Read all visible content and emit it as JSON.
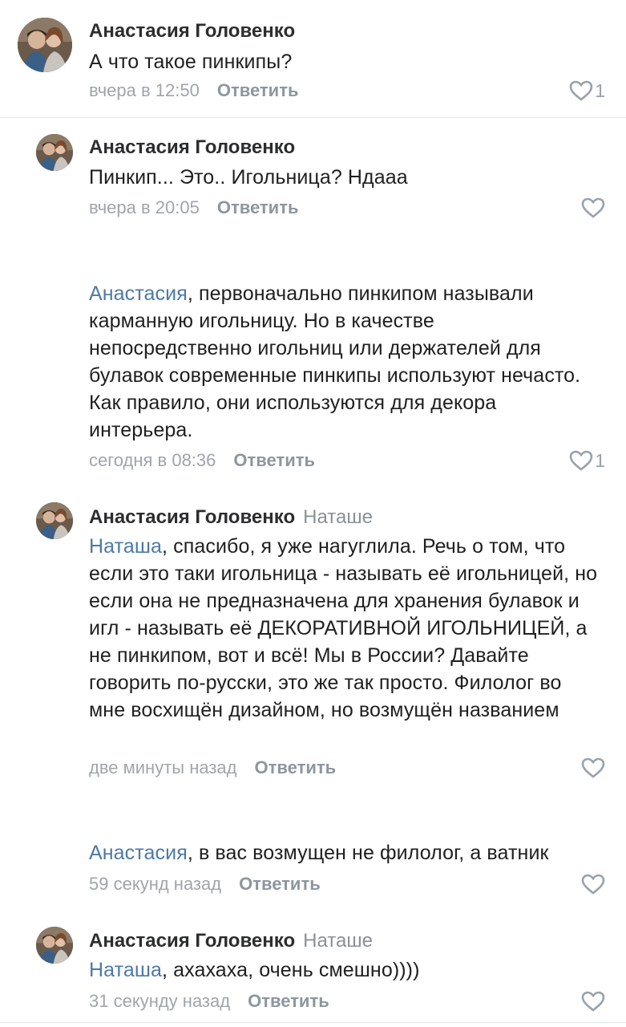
{
  "comments": [
    {
      "author": "Анастасия Головенко",
      "reply_to": "",
      "mention": "",
      "text": "А что такое пинкипы?",
      "time": "вчера в 12:50",
      "reply_label": "Ответить",
      "likes": "1"
    },
    {
      "author": "Анастасия Головенко",
      "reply_to": "",
      "mention": "",
      "text": "Пинкип... Это.. Игольница? Ндааа",
      "time": "вчера в 20:05",
      "reply_label": "Ответить",
      "likes": ""
    },
    {
      "author": "",
      "reply_to": "",
      "mention": "Анастасия",
      "text": ", первоначально пинкипом называли карманную игольницу. Но в качестве непосредственно игольниц или держателей для булавок современные пинкипы используют нечасто. Как правило, они используются для декора интерьера.",
      "time": "сегодня в 08:36",
      "reply_label": "Ответить",
      "likes": "1"
    },
    {
      "author": "Анастасия Головенко",
      "reply_to": "Наташе",
      "mention": "Наташа",
      "text": ", спасибо, я уже нагуглила. Речь о том, что если это таки игольница - называть её игольницей, но если она не предназначена для хранения булавок и игл - называть её ДЕКОРАТИВНОЙ ИГОЛЬНИЦЕЙ, а не пинкипом, вот и всё! Мы в России? Давайте говорить по-русски, это же так просто. Филолог во мне восхищён дизайном, но возмущён названием",
      "time": "две минуты назад",
      "reply_label": "Ответить",
      "likes": ""
    },
    {
      "author": "",
      "reply_to": "",
      "mention": "Анастасия",
      "text": ", в вас возмущен не филолог, а ватник",
      "time": "59 секунд назад",
      "reply_label": "Ответить",
      "likes": ""
    },
    {
      "author": "Анастасия Головенко",
      "reply_to": "Наташе",
      "mention": "Наташа",
      "text": ", ахахаха, очень смешно))))",
      "time": "31 секунду назад",
      "reply_label": "Ответить",
      "likes": ""
    }
  ],
  "icons": {
    "like": "heart-outline-icon",
    "avatar": "avatar-photo"
  },
  "colors": {
    "mention": "#4c79a6",
    "meta": "#a0a5ab",
    "reply_button": "#8d96a0",
    "heart": "#9aa2ab"
  }
}
